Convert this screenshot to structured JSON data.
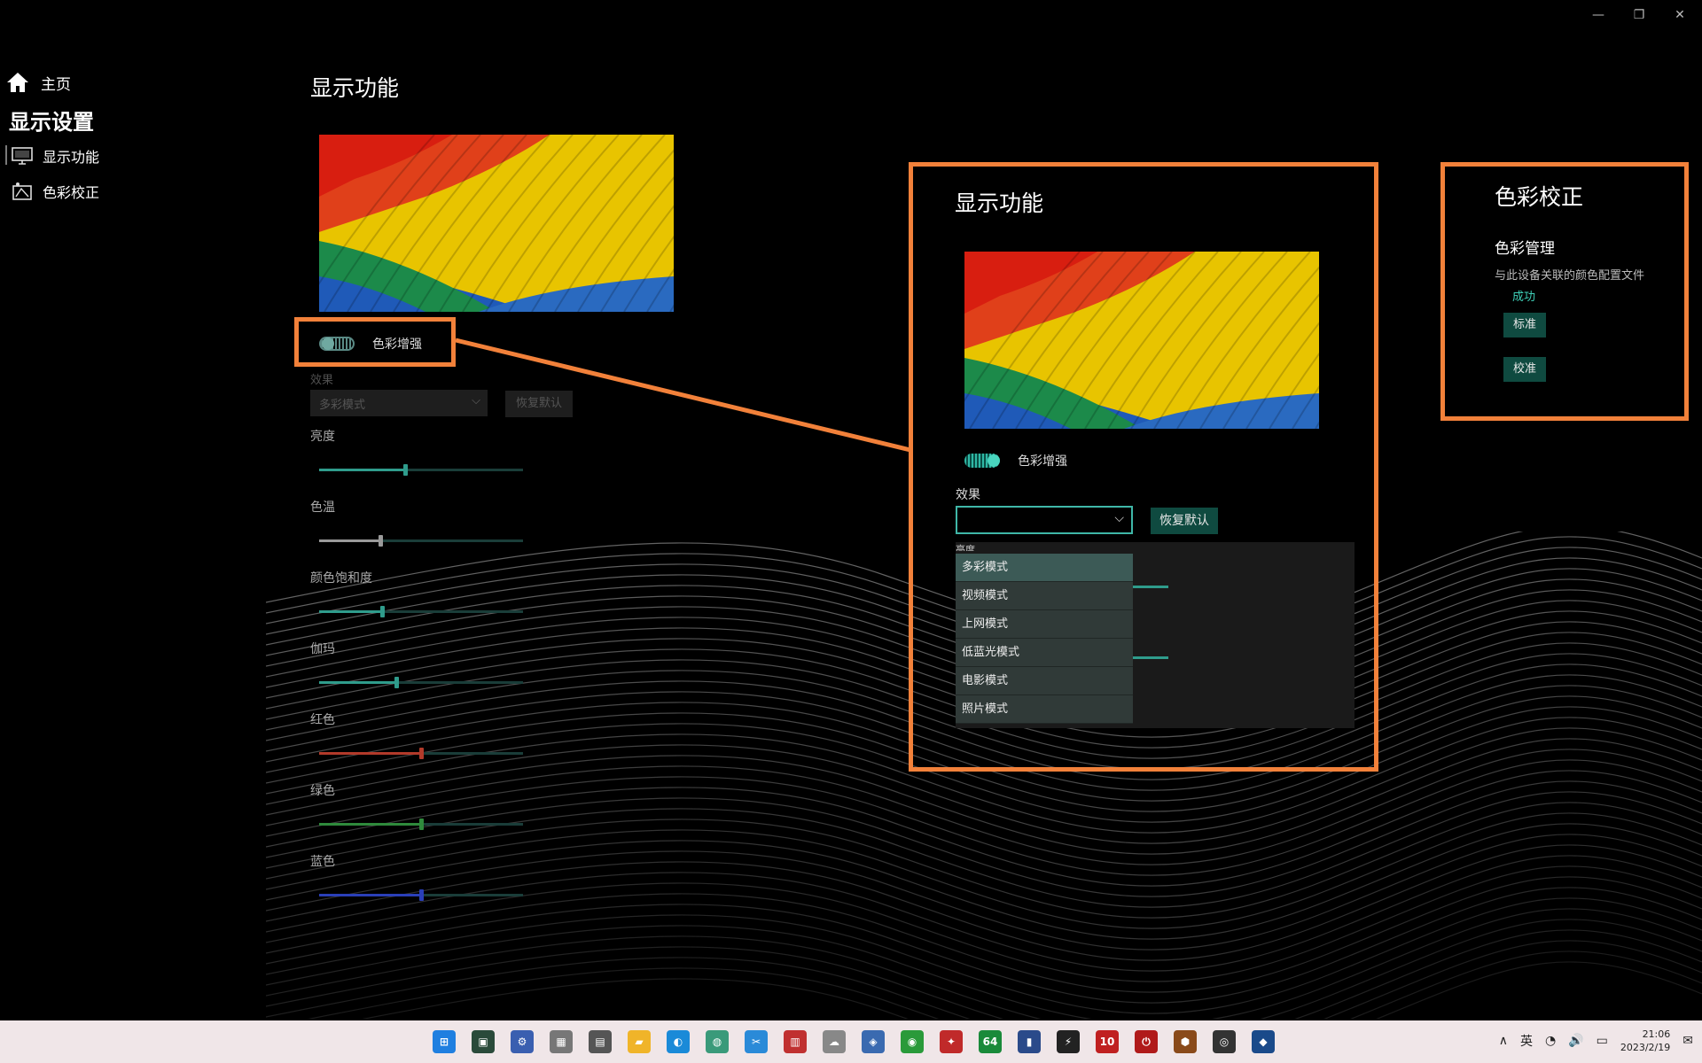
{
  "window": {
    "minimize": "—",
    "restore": "❐",
    "close": "✕"
  },
  "sidebar": {
    "home_label": "主页",
    "section_title": "显示设置",
    "items": [
      {
        "label": "显示功能",
        "icon": "monitor-icon",
        "active": true
      },
      {
        "label": "色彩校正",
        "icon": "color-calibration-icon",
        "active": false
      }
    ]
  },
  "main": {
    "title": "显示功能",
    "color_enhance_label": "色彩增强",
    "effect_label": "效果",
    "effect_value": "多彩模式",
    "reset_label": "恢复默认",
    "sliders": [
      {
        "label": "亮度",
        "value": 0.42,
        "color": "#2f9c8c"
      },
      {
        "label": "色温",
        "value": 0.3,
        "color": "#9a9a9a"
      },
      {
        "label": "颜色饱和度",
        "value": 0.31,
        "color": "#2f9c8c"
      },
      {
        "label": "伽玛",
        "value": 0.38,
        "color": "#2f9c8c"
      },
      {
        "label": "红色",
        "value": 0.5,
        "color": "#b23a2a"
      },
      {
        "label": "绿色",
        "value": 0.5,
        "color": "#2f8a3c"
      },
      {
        "label": "蓝色",
        "value": 0.5,
        "color": "#2a3fb8"
      }
    ]
  },
  "zoom": {
    "title": "显示功能",
    "color_enhance_label": "色彩增强",
    "effect_label": "效果",
    "reset_label": "恢复默认",
    "partial_label": "亮度",
    "options": [
      "多彩模式",
      "视频模式",
      "上网模式",
      "低蓝光模式",
      "电影模式",
      "照片模式"
    ],
    "selected_index": 0
  },
  "color_calibration": {
    "title": "色彩校正",
    "subtitle": "色彩管理",
    "description": "与此设备关联的颜色配置文件",
    "status": "成功",
    "btn_standard": "标准",
    "btn_calibrate": "校准"
  },
  "taskbar": {
    "icons": [
      {
        "name": "start-icon",
        "glyph": "⊞",
        "bg": "#1f7fe0"
      },
      {
        "name": "terminal-icon",
        "glyph": "▣",
        "bg": "#2a4a3a"
      },
      {
        "name": "network-monitor-icon",
        "glyph": "⚙",
        "bg": "#3a5fb0"
      },
      {
        "name": "spec-icon",
        "glyph": "▦",
        "bg": "#777777"
      },
      {
        "name": "spec2-icon",
        "glyph": "▤",
        "bg": "#555555"
      },
      {
        "name": "file-explorer-icon",
        "glyph": "▰",
        "bg": "#f0b429"
      },
      {
        "name": "edge-icon",
        "glyph": "◐",
        "bg": "#1a8ad8"
      },
      {
        "name": "globe-icon",
        "glyph": "◍",
        "bg": "#3a9a7a"
      },
      {
        "name": "snipping-icon",
        "glyph": "✂",
        "bg": "#2a8ad8"
      },
      {
        "name": "report-icon",
        "glyph": "▥",
        "bg": "#c03030"
      },
      {
        "name": "cloud-icon",
        "glyph": "☁",
        "bg": "#888888"
      },
      {
        "name": "remote-desktop-icon",
        "glyph": "◈",
        "bg": "#3a6ab0"
      },
      {
        "name": "chat-icon",
        "glyph": "◉",
        "bg": "#2a9a3a"
      },
      {
        "name": "game-icon",
        "glyph": "✦",
        "bg": "#c02a2a"
      },
      {
        "name": "aida64-icon",
        "glyph": "64",
        "bg": "#1a8a3a"
      },
      {
        "name": "equalizer-icon",
        "glyph": "▮",
        "bg": "#2a4a8a"
      },
      {
        "name": "flame-icon",
        "glyph": "⚡",
        "bg": "#222222"
      },
      {
        "name": "app-10-icon",
        "glyph": "10",
        "bg": "#c02020"
      },
      {
        "name": "power-icon",
        "glyph": "⏻",
        "bg": "#b01a1a"
      },
      {
        "name": "shield-app-icon",
        "glyph": "⬢",
        "bg": "#8a4a1a"
      },
      {
        "name": "sound-app-icon",
        "glyph": "◎",
        "bg": "#333333"
      },
      {
        "name": "display-app-icon",
        "glyph": "◆",
        "bg": "#1a4a8a"
      }
    ],
    "tray": {
      "chevron": "∧",
      "ime": "英",
      "wifi": "◔",
      "volume": "🔊",
      "battery": "▭",
      "time": "21:06",
      "date": "2023/2/19",
      "notification": "✉"
    }
  }
}
